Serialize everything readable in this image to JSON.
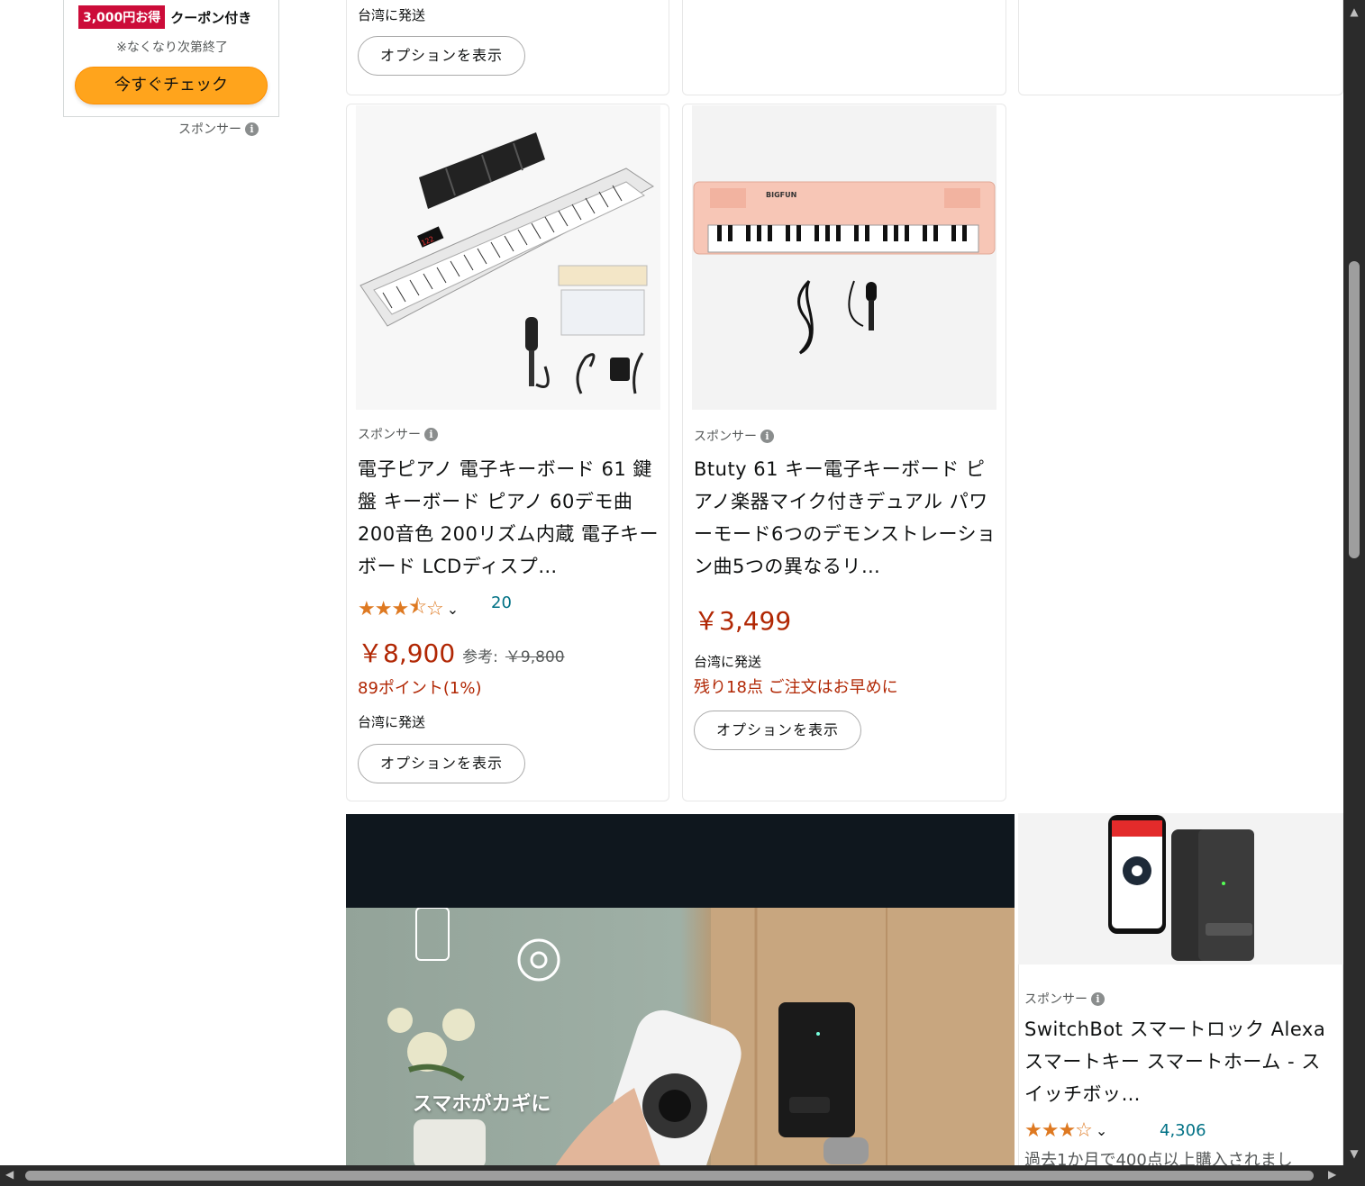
{
  "side_ad": {
    "coupon_badge": "3,000円お得",
    "coupon_text": "クーポン付き",
    "note": "※なくなり次第終了",
    "button": "今すぐチェック",
    "sponsor": "スポンサー"
  },
  "top_partial": {
    "card1_ship": "台湾に発送",
    "card1_option": "オプションを表示"
  },
  "products": [
    {
      "sponsor": "スポンサー",
      "title": "電子ピアノ 電子キーボード 61 鍵盤 キーボード ピアノ 60デモ曲 200音色 200リズム内蔵 電子キーボード LCDディスプ…",
      "rating": "3.5",
      "rating_count": "20",
      "price": "￥8,900",
      "ref_label": "参考:",
      "ref_price": "￥9,800",
      "points": "89ポイント(1%)",
      "ship": "台湾に発送",
      "option": "オプションを表示"
    },
    {
      "sponsor": "スポンサー",
      "title": "Btuty 61 キー電子キーボード ピアノ楽器マイク付きデュアル パワーモード6つのデモンストレーション曲5つの異なるリ…",
      "price": "￥3,499",
      "ship": "台湾に発送",
      "stock": "残り18点 ご注文はお早めに",
      "option": "オプションを表示"
    },
    {
      "sponsor": "スポンサー",
      "title": "SwitchBot スマートロック Alexa スマートキー スマートホーム - スイッチボッ…",
      "rating": "3",
      "rating_count": "4,306",
      "bought": "過去1か月で400点以上購入されまし"
    }
  ],
  "video": {
    "caption": "スマホがカギに"
  },
  "icons": {
    "info": "info-icon",
    "chevron": "chevron-down-icon",
    "star": "star-icon"
  },
  "colors": {
    "price": "#b12704",
    "star": "#de7921",
    "check_button": "#ffa41c",
    "coupon_badge": "#cc0c39",
    "link": "#007185"
  }
}
